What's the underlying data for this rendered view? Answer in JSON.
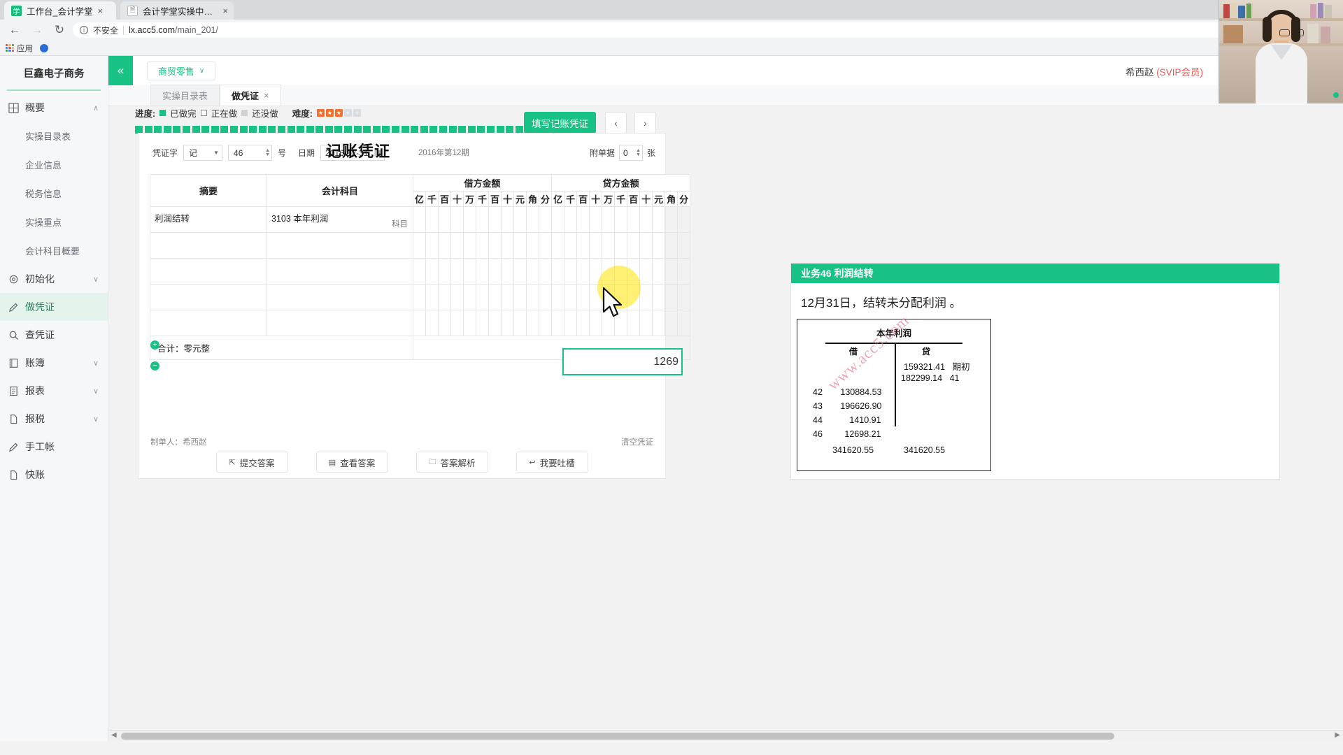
{
  "browser": {
    "tabs": [
      {
        "title": "工作台_会计学堂",
        "icon": "graduation-cap-icon",
        "active": true,
        "close_label": "×"
      },
      {
        "title": "会计学堂实操中心_会计学",
        "icon": "document-icon",
        "active": false,
        "close_label": "×"
      }
    ],
    "nav": {
      "back": "←",
      "forward": "→",
      "reload": "↻"
    },
    "omnibox": {
      "security_label": "不安全",
      "info_glyph": "i",
      "url_host": "lx.acc5.com",
      "url_path": "/main_201/"
    },
    "bookmarks": [
      {
        "label": "应用",
        "icon": "apps-grid-icon"
      },
      {
        "label": "",
        "icon": "blue-site-icon"
      }
    ]
  },
  "sidebar": {
    "brand": "巨鑫电子商务",
    "items": [
      {
        "label": "概要",
        "icon": "dashboard-icon",
        "chevron": "∧",
        "active": false,
        "expanded": true
      },
      {
        "label": "实操目录表",
        "sub": true
      },
      {
        "label": "企业信息",
        "sub": true
      },
      {
        "label": "税务信息",
        "sub": true
      },
      {
        "label": "实操重点",
        "sub": true
      },
      {
        "label": "会计科目概要",
        "sub": true
      },
      {
        "label": "初始化",
        "icon": "gear-icon",
        "chevron": "∨",
        "active": false
      },
      {
        "label": "做凭证",
        "icon": "pen-icon",
        "chevron": "",
        "active": true
      },
      {
        "label": "查凭证",
        "icon": "search-icon",
        "chevron": "",
        "active": false
      },
      {
        "label": "账簿",
        "icon": "book-icon",
        "chevron": "∨",
        "active": false
      },
      {
        "label": "报表",
        "icon": "report-icon",
        "chevron": "∨",
        "active": false
      },
      {
        "label": "报税",
        "icon": "file-icon",
        "chevron": "∨",
        "active": false
      },
      {
        "label": "手工帐",
        "icon": "pen-icon",
        "chevron": "",
        "active": false
      },
      {
        "label": "快账",
        "icon": "file-icon",
        "chevron": "",
        "active": false
      }
    ]
  },
  "topbar": {
    "collapse_glyph": "«",
    "industry_select": "商贸零售",
    "industry_caret": "∨",
    "user_name": "希西赵",
    "user_level": "(SVIP会员)"
  },
  "page_tabs": [
    {
      "label": "实操目录表",
      "selected": false,
      "closable": false
    },
    {
      "label": "做凭证",
      "selected": true,
      "closable": true,
      "close_label": "×"
    }
  ],
  "progress": {
    "label": "进度:",
    "legend": [
      {
        "state": "done",
        "label": "已做完"
      },
      {
        "state": "doing",
        "label": "正在做"
      },
      {
        "state": "todo",
        "label": "还没做"
      }
    ],
    "difficulty_label": "难度:",
    "difficulty_filled": 3,
    "difficulty_total": 5,
    "star_glyph": "★",
    "cells_done": 44,
    "cells_doing": 1,
    "cells_todo": 2
  },
  "actions": {
    "fill_voucher": "填写记账凭证",
    "prev": "‹",
    "next": "›"
  },
  "voucher": {
    "word_label": "凭证字",
    "word_value": "记",
    "number_value": "46",
    "number_suffix": "号",
    "date_label": "日期",
    "date_value": "2016-12-31",
    "title": "记账凭证",
    "period": "2016年第12期",
    "attach_label": "附单据",
    "attach_value": "0",
    "attach_unit": "张",
    "columns": {
      "summary": "摘要",
      "subject": "会计科目",
      "debit": "借方金额",
      "credit": "贷方金额"
    },
    "digit_units": [
      "亿",
      "千",
      "百",
      "十",
      "万",
      "千",
      "百",
      "十",
      "元",
      "角",
      "分"
    ],
    "rows": [
      {
        "summary": "利润结转",
        "subject": "3103 本年利润",
        "subject_hint": "科目",
        "debit": "1269",
        "credit": ""
      },
      {
        "summary": "",
        "subject": "",
        "subject_hint": "",
        "debit": "",
        "credit": ""
      },
      {
        "summary": "",
        "subject": "",
        "subject_hint": "",
        "debit": "",
        "credit": ""
      },
      {
        "summary": "",
        "subject": "",
        "subject_hint": "",
        "debit": "",
        "credit": ""
      },
      {
        "summary": "",
        "subject": "",
        "subject_hint": "",
        "debit": "",
        "credit": ""
      }
    ],
    "active_cell_value": "1269",
    "total_label": "合计：零元整",
    "maker_label": "制单人：希西赵",
    "clear_label": "清空凭证",
    "row_add_glyph": "+",
    "row_del_glyph": "−",
    "buttons": [
      {
        "label": "提交答案",
        "icon": "external-link-icon"
      },
      {
        "label": "查看答案",
        "icon": "list-icon"
      },
      {
        "label": "答案解析",
        "icon": "folder-icon"
      },
      {
        "label": "我要吐槽",
        "icon": "reply-icon"
      }
    ]
  },
  "task": {
    "header": "业务46 利润结转",
    "description": "12月31日，结转未分配利润 。",
    "t_account": {
      "title": "本年利润",
      "debit_header": "借",
      "credit_header": "贷",
      "credit_entries": [
        {
          "amount": "159321.41",
          "note": "期初"
        },
        {
          "amount": "182299.14",
          "note": "41"
        }
      ],
      "debit_entries": [
        {
          "no": "42",
          "amount": "130884.53"
        },
        {
          "no": "43",
          "amount": "196626.90"
        },
        {
          "no": "44",
          "amount": "1410.91"
        },
        {
          "no": "46",
          "amount": "12698.21"
        }
      ],
      "debit_total": "341620.55",
      "credit_total": "341620.55",
      "watermark": "www.acc5.com"
    }
  },
  "webcam": {
    "status": "live"
  },
  "colors": {
    "accent": "#18c184",
    "warning": "#f2702c",
    "danger": "#e8554e",
    "sidebar_bg": "#f5f7f8"
  }
}
